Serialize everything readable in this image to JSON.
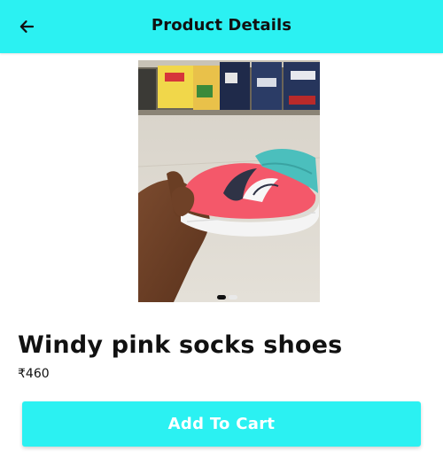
{
  "header": {
    "title": "Product Details",
    "back_icon": "arrow-left-icon"
  },
  "carousel": {
    "total_slides": 2,
    "active_slide": 1,
    "image_subject": "pink-and-teal-knit-shoe-photo"
  },
  "product": {
    "name": "Windy pink socks shoes",
    "price": "₹460"
  },
  "actions": {
    "add_to_cart_label": "Add To Cart"
  },
  "colors": {
    "accent": "#2bf1f2",
    "text": "#111111",
    "button_text": "#ffffff"
  }
}
